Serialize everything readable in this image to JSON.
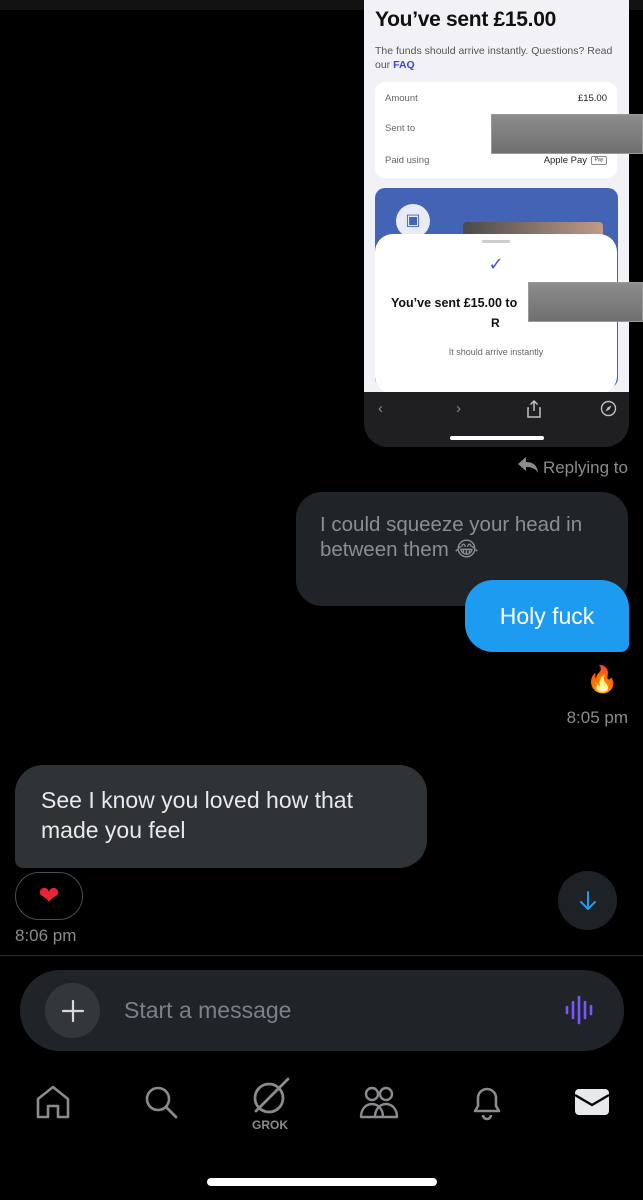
{
  "shared_screenshot": {
    "title": "You’ve sent £15.00",
    "subtitle": "The funds should arrive instantly. Questions? Read our",
    "faq_link": "FAQ",
    "rows": [
      {
        "label": "Amount",
        "value": "£15.00"
      },
      {
        "label": "Sent to",
        "value": ""
      },
      {
        "label": "Paid using",
        "value": "Apple Pay"
      }
    ],
    "pay_badge": "Pay",
    "sheet_title": "You’ve sent £15.00 to",
    "sheet_name": "R",
    "sheet_subtitle": "It should arrive instantly"
  },
  "thread": {
    "replying_label": "Replying to",
    "quoted_message": "I could squeeze your head in between them 😂",
    "sent_message": "Holy fuck",
    "sent_reaction": "🔥",
    "sent_time": "8:05 pm",
    "received_message": "See I know you loved how that made you feel",
    "received_reaction": "❤",
    "received_time": "8:06 pm"
  },
  "composer": {
    "placeholder": "Start a message"
  },
  "nav": {
    "grok_label": "GROK",
    "items": [
      "home-icon",
      "search-icon",
      "grok-icon",
      "communities-icon",
      "notifications-icon",
      "messages-icon"
    ]
  },
  "colors": {
    "accent": "#1d9bf0",
    "sent_bubble": "#1d9bf0",
    "received_bubble": "#2f3336",
    "voice_icon": "#7856ff"
  }
}
